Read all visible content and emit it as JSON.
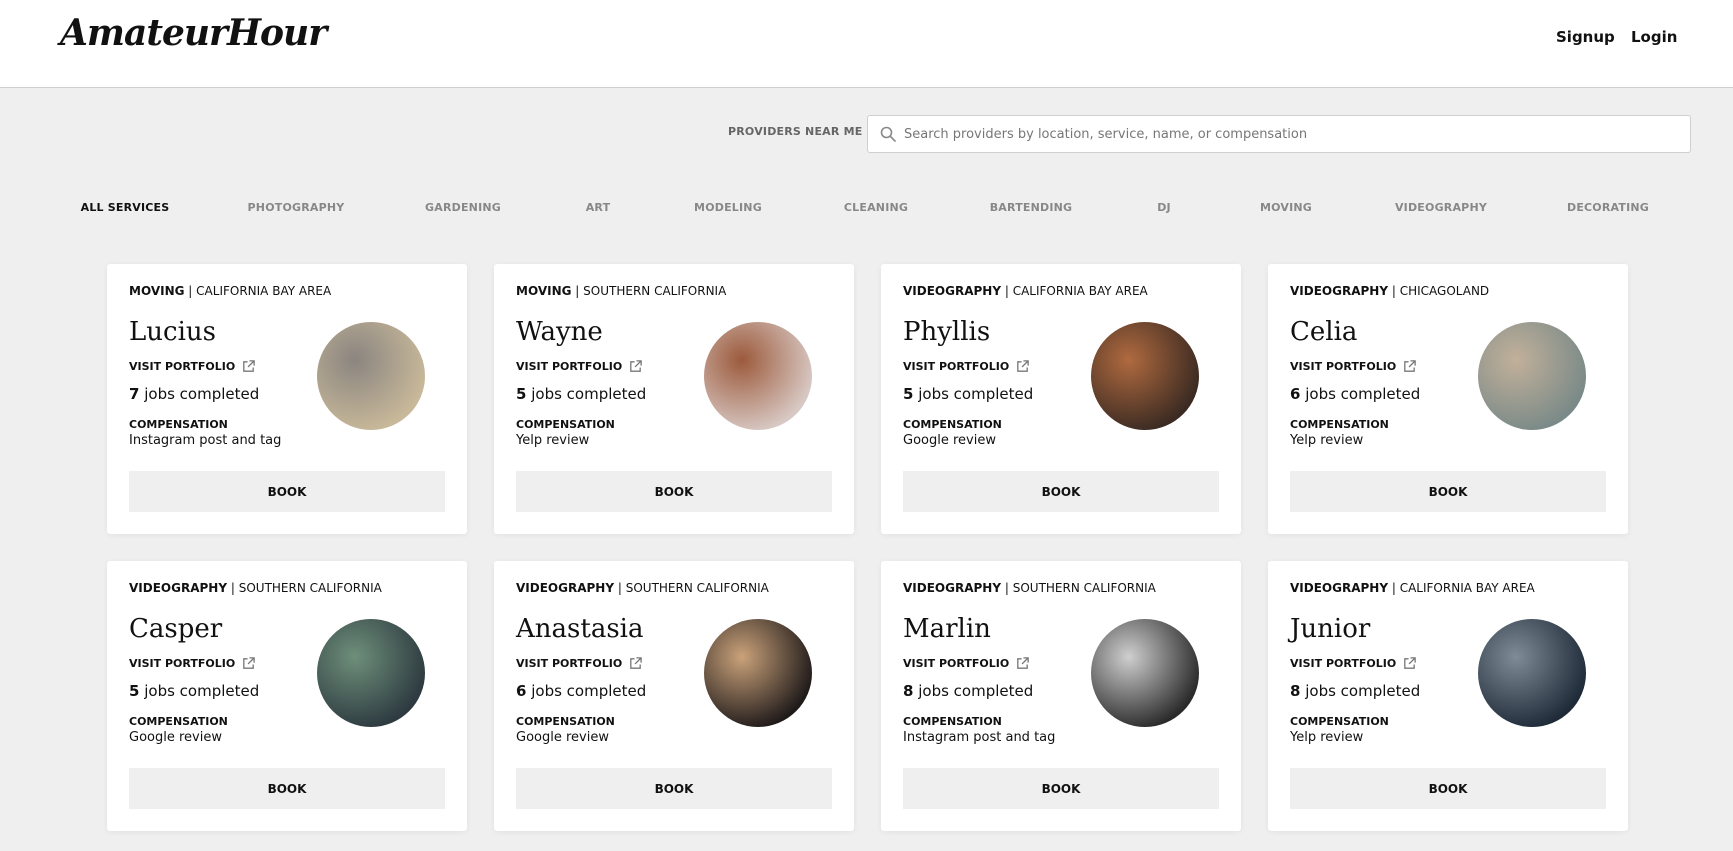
{
  "header": {
    "logo": "AmateurHour",
    "signup": "Signup",
    "login": "Login"
  },
  "search": {
    "label": "PROVIDERS NEAR ME",
    "placeholder": "Search providers by location, service, name, or compensation",
    "value": ""
  },
  "categories": [
    {
      "label": "ALL SERVICES",
      "active": true
    },
    {
      "label": "PHOTOGRAPHY",
      "active": false
    },
    {
      "label": "GARDENING",
      "active": false
    },
    {
      "label": "ART",
      "active": false
    },
    {
      "label": "MODELING",
      "active": false
    },
    {
      "label": "CLEANING",
      "active": false
    },
    {
      "label": "BARTENDING",
      "active": false
    },
    {
      "label": "DJ",
      "active": false
    },
    {
      "label": "MOVING",
      "active": false
    },
    {
      "label": "VIDEOGRAPHY",
      "active": false
    },
    {
      "label": "DECORATING",
      "active": false
    }
  ],
  "card_labels": {
    "visit_portfolio": "VISIT PORTFOLIO",
    "jobs_suffix": "jobs completed",
    "compensation": "COMPENSATION",
    "book": "BOOK",
    "separator": "|"
  },
  "providers": [
    {
      "service": "MOVING",
      "region": "CALIFORNIA BAY AREA",
      "name": "Lucius",
      "jobs": "7",
      "compensation": "Instagram post and tag",
      "photo_colors": [
        "#c9b99a",
        "#8a8580"
      ]
    },
    {
      "service": "MOVING",
      "region": "SOUTHERN CALIFORNIA",
      "name": "Wayne",
      "jobs": "5",
      "compensation": "Yelp review",
      "photo_colors": [
        "#d8c9c4",
        "#9c5a3c"
      ]
    },
    {
      "service": "VIDEOGRAPHY",
      "region": "CALIFORNIA BAY AREA",
      "name": "Phyllis",
      "jobs": "5",
      "compensation": "Google review",
      "photo_colors": [
        "#3a2a22",
        "#b06a3f"
      ]
    },
    {
      "service": "VIDEOGRAPHY",
      "region": "CHICAGOLAND",
      "name": "Celia",
      "jobs": "6",
      "compensation": "Yelp review",
      "photo_colors": [
        "#7a8a88",
        "#c2b09a"
      ]
    },
    {
      "service": "VIDEOGRAPHY",
      "region": "SOUTHERN CALIFORNIA",
      "name": "Casper",
      "jobs": "5",
      "compensation": "Google review",
      "photo_colors": [
        "#2d3a40",
        "#6e8f7a"
      ]
    },
    {
      "service": "VIDEOGRAPHY",
      "region": "SOUTHERN CALIFORNIA",
      "name": "Anastasia",
      "jobs": "6",
      "compensation": "Google review",
      "photo_colors": [
        "#1f1a1a",
        "#caa27a"
      ]
    },
    {
      "service": "VIDEOGRAPHY",
      "region": "SOUTHERN CALIFORNIA",
      "name": "Marlin",
      "jobs": "8",
      "compensation": "Instagram post and tag",
      "photo_colors": [
        "#2a2a2a",
        "#cfcfcf"
      ]
    },
    {
      "service": "VIDEOGRAPHY",
      "region": "CALIFORNIA BAY AREA",
      "name": "Junior",
      "jobs": "8",
      "compensation": "Yelp review",
      "photo_colors": [
        "#1e2a38",
        "#7f8c96"
      ]
    }
  ],
  "icons": {
    "search": "search-icon",
    "portfolio": "external-link-icon"
  }
}
